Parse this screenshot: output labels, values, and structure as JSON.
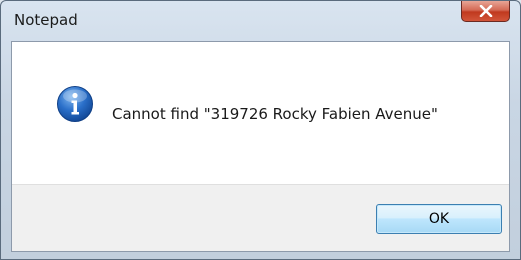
{
  "window": {
    "title": "Notepad"
  },
  "titlebar": {
    "close_icon": "close-x-icon"
  },
  "dialog": {
    "icon": "information-icon",
    "message": "Cannot find \"319726 Rocky Fabien Avenue\"",
    "ok_label": "OK"
  },
  "colors": {
    "close_button": "#c7432a",
    "ok_button_border": "#3c7fb1",
    "info_icon": "#2a6fc9"
  }
}
